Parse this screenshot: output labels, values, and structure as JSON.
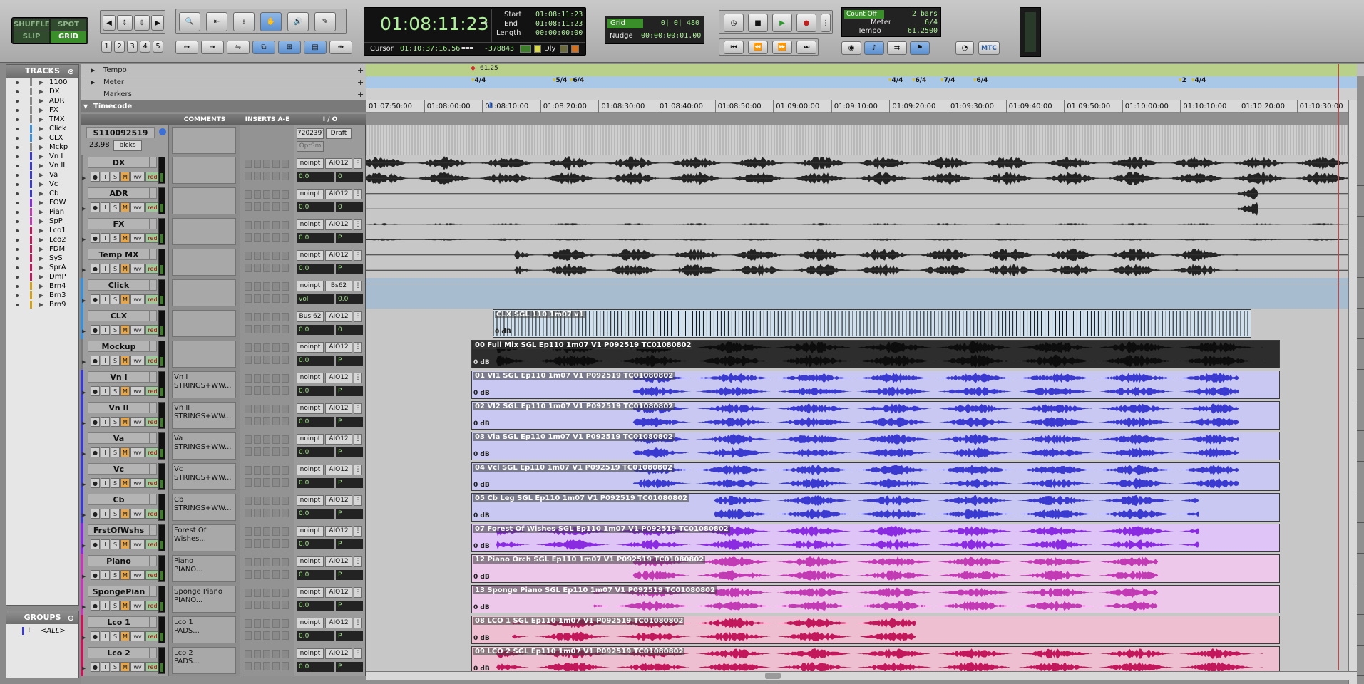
{
  "toolbar": {
    "modes": {
      "shuffle": "SHUFFLE",
      "spot": "SPOT",
      "slip": "SLIP",
      "grid": "GRID"
    },
    "zoom_presets": [
      "1",
      "2",
      "3",
      "4",
      "5"
    ],
    "counter": {
      "main": "01:08:11:23",
      "start_label": "Start",
      "start": "01:08:11:23",
      "end_label": "End",
      "end": "01:08:11:23",
      "length_label": "Length",
      "length": "00:00:00:00",
      "cursor_label": "Cursor",
      "cursor": "01:10:37:16.56",
      "cursor_sample": "-378843",
      "dly": "Dly"
    },
    "grid": {
      "label": "Grid",
      "value": "0| 0| 480",
      "nudge_label": "Nudge",
      "nudge_value": "00:00:00:01.00"
    },
    "midi": {
      "count_off": "Count Off",
      "count_bars": "2 bars",
      "meter_label": "Meter",
      "meter_value": "6/4",
      "tempo_label": "Tempo",
      "tempo_value": "61.2500",
      "mtc": "MTC"
    }
  },
  "tracklist": {
    "title": "TRACKS",
    "items": [
      {
        "name": "1100",
        "color": "#888888"
      },
      {
        "name": "DX",
        "color": "#888888"
      },
      {
        "name": "ADR",
        "color": "#888888"
      },
      {
        "name": "FX",
        "color": "#888888"
      },
      {
        "name": "TMX",
        "color": "#888888"
      },
      {
        "name": "Click",
        "color": "#3b8fd8"
      },
      {
        "name": "CLX",
        "color": "#3b8fd8"
      },
      {
        "name": "Mckp",
        "color": "#888888"
      },
      {
        "name": "Vn I",
        "color": "#3a3ad0"
      },
      {
        "name": "Vn II",
        "color": "#3a3ad0"
      },
      {
        "name": "Va",
        "color": "#3a3ad0"
      },
      {
        "name": "Vc",
        "color": "#3a3ad0"
      },
      {
        "name": "Cb",
        "color": "#3a3ad0"
      },
      {
        "name": "FOW",
        "color": "#8a2be2"
      },
      {
        "name": "Pian",
        "color": "#c23bb5"
      },
      {
        "name": "SpP",
        "color": "#c23bb5"
      },
      {
        "name": "Lco1",
        "color": "#c2185b"
      },
      {
        "name": "Lco2",
        "color": "#c2185b"
      },
      {
        "name": "FDM",
        "color": "#c2185b"
      },
      {
        "name": "SyS",
        "color": "#c2185b"
      },
      {
        "name": "SprA",
        "color": "#c2185b"
      },
      {
        "name": "DmP",
        "color": "#c2185b"
      },
      {
        "name": "Brn4",
        "color": "#d4a017"
      },
      {
        "name": "Brn3",
        "color": "#d4a017"
      },
      {
        "name": "Brn9",
        "color": "#d4a017"
      }
    ]
  },
  "groups": {
    "title": "GROUPS",
    "all": "<ALL>"
  },
  "rulers": {
    "tempo": {
      "label": "Tempo",
      "value": "61.25"
    },
    "meter": {
      "label": "Meter",
      "marks": [
        "4/4",
        "5/4",
        "6/4",
        "4/4",
        "6/4",
        "7/4",
        "6/4",
        "2",
        "4/4"
      ]
    },
    "markers": {
      "label": "Markers"
    },
    "timecode": {
      "label": "Timecode",
      "ticks": [
        "01:07:50:00",
        "01:08:00:00",
        "01:08:10:00",
        "01:08:20:00",
        "01:08:30:00",
        "01:08:40:00",
        "01:08:50:00",
        "01:09:00:00",
        "01:09:10:00",
        "01:09:20:00",
        "01:09:30:00",
        "01:09:40:00",
        "01:09:50:00",
        "01:10:00:00",
        "01:10:10:00",
        "01:10:20:00",
        "01:10:30:00"
      ]
    }
  },
  "columns": {
    "comments": "COMMENTS",
    "inserts": "INSERTS A-E",
    "io": "I / O"
  },
  "video_track": {
    "name": "S110092519",
    "fps": "23.98",
    "blocks": "blcks",
    "tc": "7202397",
    "draft": "Draft",
    "opt": "OptSm"
  },
  "tracks": [
    {
      "name": "DX",
      "color": "#7a7a7a",
      "comment": "",
      "in": "noinpt",
      "out": "AIO12",
      "vol": "0.0",
      "pan": "0",
      "clip": null
    },
    {
      "name": "ADR",
      "color": "#7a7a7a",
      "comment": "",
      "in": "noinpt",
      "out": "AIO12",
      "vol": "0.0",
      "pan": "0",
      "clip": null
    },
    {
      "name": "FX",
      "color": "#7a7a7a",
      "comment": "",
      "in": "noinpt",
      "out": "AIO12",
      "vol": "0.0",
      "pan": "P",
      "clip": null
    },
    {
      "name": "Temp MX",
      "color": "#7a7a7a",
      "comment": "",
      "in": "noinpt",
      "out": "AIO12",
      "vol": "0.0",
      "pan": "P",
      "clip": null
    },
    {
      "name": "Click",
      "color": "#3b8fd8",
      "comment": "",
      "in": "noinpt",
      "out": "Bs62",
      "vol": "vol",
      "pan": "0.0",
      "clip": null
    },
    {
      "name": "CLX",
      "color": "#3b8fd8",
      "comment": "",
      "in": "Bus 62",
      "out": "AIO12",
      "vol": "0.0",
      "pan": "0",
      "clip": {
        "name": "CLX SGL 110 1m07 v1",
        "db": "0 dB"
      }
    },
    {
      "name": "Mockup",
      "color": "#7a7a7a",
      "comment": "",
      "in": "noinpt",
      "out": "AIO12",
      "vol": "0.0",
      "pan": "P",
      "clip": {
        "name": "00 Full Mix SGL Ep110 1m07 V1 P092519 TC01080802",
        "db": "0 dB"
      }
    },
    {
      "name": "Vn I",
      "color": "#3a3ad0",
      "comment": "Vn I\nSTRINGS+WW...",
      "in": "noinpt",
      "out": "AIO12",
      "vol": "0.0",
      "pan": "P",
      "clip": {
        "name": "01 VI1 SGL Ep110 1m07 V1 P092519 TC01080802",
        "db": "0 dB"
      }
    },
    {
      "name": "Vn II",
      "color": "#3a3ad0",
      "comment": "Vn II\nSTRINGS+WW...",
      "in": "noinpt",
      "out": "AIO12",
      "vol": "0.0",
      "pan": "P",
      "clip": {
        "name": "02 VI2 SGL Ep110 1m07 V1 P092519 TC01080802",
        "db": "0 dB"
      }
    },
    {
      "name": "Va",
      "color": "#3a3ad0",
      "comment": "Va\nSTRINGS+WW...",
      "in": "noinpt",
      "out": "AIO12",
      "vol": "0.0",
      "pan": "P",
      "clip": {
        "name": "03 Vla SGL Ep110 1m07 V1 P092519 TC01080802",
        "db": "0 dB"
      }
    },
    {
      "name": "Vc",
      "color": "#3a3ad0",
      "comment": "Vc\nSTRINGS+WW...",
      "in": "noinpt",
      "out": "AIO12",
      "vol": "0.0",
      "pan": "P",
      "clip": {
        "name": "04 Vcl SGL Ep110 1m07 V1 P092519 TC01080802",
        "db": "0 dB"
      }
    },
    {
      "name": "Cb",
      "color": "#3a3ad0",
      "comment": "Cb\nSTRINGS+WW...",
      "in": "noinpt",
      "out": "AIO12",
      "vol": "0.0",
      "pan": "P",
      "clip": {
        "name": "05 Cb Leg SGL Ep110 1m07 V1 P092519 TC01080802",
        "db": "0 dB"
      }
    },
    {
      "name": "FrstOfWshs",
      "color": "#8a2be2",
      "comment": "Forest Of\nWishes...",
      "in": "noinpt",
      "out": "AIO12",
      "vol": "0.0",
      "pan": "P",
      "clip": {
        "name": "07 Forest Of Wishes SGL Ep110 1m07 V1 P092519 TC01080802",
        "db": "0 dB"
      }
    },
    {
      "name": "Piano",
      "color": "#c23bb5",
      "comment": "Piano\nPIANO...",
      "in": "noinpt",
      "out": "AIO12",
      "vol": "0.0",
      "pan": "P",
      "clip": {
        "name": "12 Piano Orch SGL Ep110 1m07 V1 P092519 TC01080802",
        "db": "0 dB"
      }
    },
    {
      "name": "SpongePian",
      "color": "#c23bb5",
      "comment": "Sponge Piano\nPIANO...",
      "in": "noinpt",
      "out": "AIO12",
      "vol": "0.0",
      "pan": "P",
      "clip": {
        "name": "13 Sponge Piano SGL Ep110 1m07 V1 P092519 TC01080802",
        "db": "0 dB"
      }
    },
    {
      "name": "Lco 1",
      "color": "#c2185b",
      "comment": "Lco 1\nPADS...",
      "in": "noinpt",
      "out": "AIO12",
      "vol": "0.0",
      "pan": "P",
      "clip": {
        "name": "08 LCO 1 SGL Ep110 1m07 V1 P092519 TC01080802",
        "db": "0 dB"
      }
    },
    {
      "name": "Lco 2",
      "color": "#c2185b",
      "comment": "Lco 2\nPADS...",
      "in": "noinpt",
      "out": "AIO12",
      "vol": "0.0",
      "pan": "P",
      "clip": {
        "name": "09 LCO 2 SGL Ep110 1m07 V1 P092519 TC01080802",
        "db": "0 dB"
      }
    }
  ],
  "colors": {
    "tempo_ruler": "#b8d08a",
    "meter_ruler": "#a9c8e8",
    "accent_green": "#9fe089",
    "playhead": "#e03a3a"
  }
}
